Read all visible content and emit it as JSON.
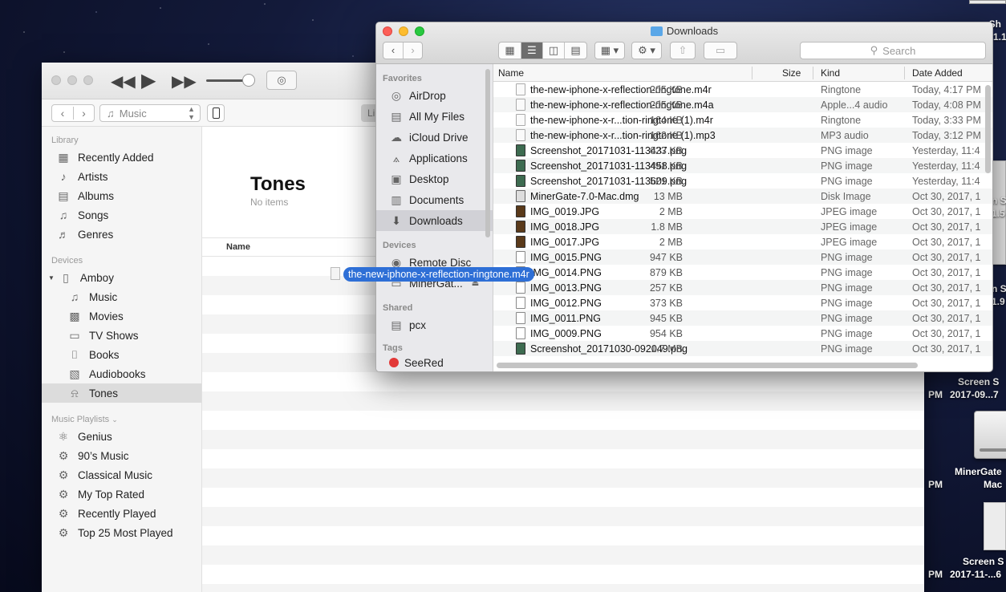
{
  "desktop": {
    "right_labels": [
      "n Sh",
      "1.1",
      "Screen S",
      "PM",
      "2017-09...7",
      "MinerGate",
      "Mac",
      "Screen S",
      "PM",
      "2017-11-...6"
    ],
    "left_clip_labels": [
      "n S",
      "1.5",
      "n S",
      "1.9"
    ]
  },
  "itunes": {
    "media_kind": "Music",
    "library_tab": "Li",
    "library_section": "Library",
    "library_items": [
      {
        "label": "Recently Added",
        "icon": "grid-icon"
      },
      {
        "label": "Artists",
        "icon": "microphone-icon"
      },
      {
        "label": "Albums",
        "icon": "album-icon"
      },
      {
        "label": "Songs",
        "icon": "note-icon"
      },
      {
        "label": "Genres",
        "icon": "guitar-icon"
      }
    ],
    "devices_section": "Devices",
    "device_name": "Amboy",
    "device_items": [
      {
        "label": "Music",
        "icon": "note-icon"
      },
      {
        "label": "Movies",
        "icon": "film-icon"
      },
      {
        "label": "TV Shows",
        "icon": "tv-icon"
      },
      {
        "label": "Books",
        "icon": "book-icon"
      },
      {
        "label": "Audiobooks",
        "icon": "audiobook-icon"
      },
      {
        "label": "Tones",
        "icon": "bell-icon",
        "selected": true
      }
    ],
    "playlists_section": "Music Playlists",
    "playlists": [
      {
        "label": "Genius",
        "icon": "genius-icon"
      },
      {
        "label": "90’s Music",
        "icon": "gear-icon"
      },
      {
        "label": "Classical Music",
        "icon": "gear-icon"
      },
      {
        "label": "My Top Rated",
        "icon": "gear-icon"
      },
      {
        "label": "Recently Played",
        "icon": "gear-icon"
      },
      {
        "label": "Top 25 Most Played",
        "icon": "gear-icon"
      }
    ],
    "page_title": "Tones",
    "page_subtitle": "No items",
    "column_name": "Name"
  },
  "finder": {
    "title": "Downloads",
    "search_placeholder": "Search",
    "favorites_section": "Favorites",
    "favorites": [
      {
        "label": "AirDrop",
        "icon": "airdrop-icon"
      },
      {
        "label": "All My Files",
        "icon": "files-icon"
      },
      {
        "label": "iCloud Drive",
        "icon": "cloud-icon"
      },
      {
        "label": "Applications",
        "icon": "applications-icon"
      },
      {
        "label": "Desktop",
        "icon": "desktop-icon"
      },
      {
        "label": "Documents",
        "icon": "documents-icon"
      },
      {
        "label": "Downloads",
        "icon": "downloads-icon",
        "selected": true
      }
    ],
    "devices_section": "Devices",
    "devices": [
      {
        "label": "Remote Disc",
        "icon": "disc-icon"
      },
      {
        "label": "MinerGat...",
        "icon": "drive-icon"
      }
    ],
    "shared_section": "Shared",
    "shared": [
      {
        "label": "pcx",
        "icon": "computer-icon"
      }
    ],
    "tags_section": "Tags",
    "tags": [
      {
        "label": "SeeRed",
        "color": "#e23838"
      }
    ],
    "columns": {
      "name": "Name",
      "size": "Size",
      "kind": "Kind",
      "date": "Date Added"
    },
    "files": [
      {
        "name": "the-new-iphone-x-reflection-ringtone.m4r",
        "size": "205 KB",
        "kind": "Ringtone",
        "date": "Today, 4:17 PM",
        "icon": "audio-file-icon"
      },
      {
        "name": "the-new-iphone-x-reflection-ringtone.m4a",
        "size": "205 KB",
        "kind": "Apple...4 audio",
        "date": "Today, 4:08 PM",
        "icon": "audio-file-icon"
      },
      {
        "name": "the-new-iphone-x-r...tion-ringtone (1).m4r",
        "size": "164 KB",
        "kind": "Ringtone",
        "date": "Today, 3:33 PM",
        "icon": "audio-file-icon"
      },
      {
        "name": "the-new-iphone-x-r...tion-ringtone (1).mp3",
        "size": "162 KB",
        "kind": "MP3 audio",
        "date": "Today, 3:12 PM",
        "icon": "audio-file-icon"
      },
      {
        "name": "Screenshot_20171031-113437.png",
        "size": "623 KB",
        "kind": "PNG image",
        "date": "Yesterday, 11:4",
        "icon": "screenshot-file-icon"
      },
      {
        "name": "Screenshot_20171031-113458.png",
        "size": "491 KB",
        "kind": "PNG image",
        "date": "Yesterday, 11:4",
        "icon": "screenshot-file-icon"
      },
      {
        "name": "Screenshot_20171031-113609.png",
        "size": "521 KB",
        "kind": "PNG image",
        "date": "Yesterday, 11:4",
        "icon": "screenshot-file-icon"
      },
      {
        "name": "MinerGate-7.0-Mac.dmg",
        "size": "13 MB",
        "kind": "Disk Image",
        "date": "Oct 30, 2017, 1",
        "icon": "dmg-file-icon"
      },
      {
        "name": "IMG_0019.JPG",
        "size": "2 MB",
        "kind": "JPEG image",
        "date": "Oct 30, 2017, 1",
        "icon": "jpeg-file-icon"
      },
      {
        "name": "IMG_0018.JPG",
        "size": "1.8 MB",
        "kind": "JPEG image",
        "date": "Oct 30, 2017, 1",
        "icon": "jpeg-file-icon"
      },
      {
        "name": "IMG_0017.JPG",
        "size": "2 MB",
        "kind": "JPEG image",
        "date": "Oct 30, 2017, 1",
        "icon": "jpeg-file-icon"
      },
      {
        "name": "IMG_0015.PNG",
        "size": "947 KB",
        "kind": "PNG image",
        "date": "Oct 30, 2017, 1",
        "icon": "png-file-icon"
      },
      {
        "name": "IMG_0014.PNG",
        "size": "879 KB",
        "kind": "PNG image",
        "date": "Oct 30, 2017, 1",
        "icon": "png-file-icon"
      },
      {
        "name": "IMG_0013.PNG",
        "size": "257 KB",
        "kind": "PNG image",
        "date": "Oct 30, 2017, 1",
        "icon": "png-file-icon"
      },
      {
        "name": "IMG_0012.PNG",
        "size": "373 KB",
        "kind": "PNG image",
        "date": "Oct 30, 2017, 1",
        "icon": "png-file-icon"
      },
      {
        "name": "IMG_0011.PNG",
        "size": "945 KB",
        "kind": "PNG image",
        "date": "Oct 30, 2017, 1",
        "icon": "png-file-icon"
      },
      {
        "name": "IMG_0009.PNG",
        "size": "954 KB",
        "kind": "PNG image",
        "date": "Oct 30, 2017, 1",
        "icon": "png-file-icon"
      },
      {
        "name": "Screenshot_20171030-092049.png",
        "size": "1.7 MB",
        "kind": "PNG image",
        "date": "Oct 30, 2017, 1",
        "icon": "screenshot-file-icon"
      }
    ]
  },
  "drag": {
    "label": "the-new-iphone-x-reflection-ringtone.m4r"
  },
  "colors": {
    "selection_blue": "#2e6fd6",
    "close_red": "#fc5f57",
    "minimize_yellow": "#fdbc2e",
    "zoom_green": "#28c840",
    "tag_red": "#e23838"
  }
}
